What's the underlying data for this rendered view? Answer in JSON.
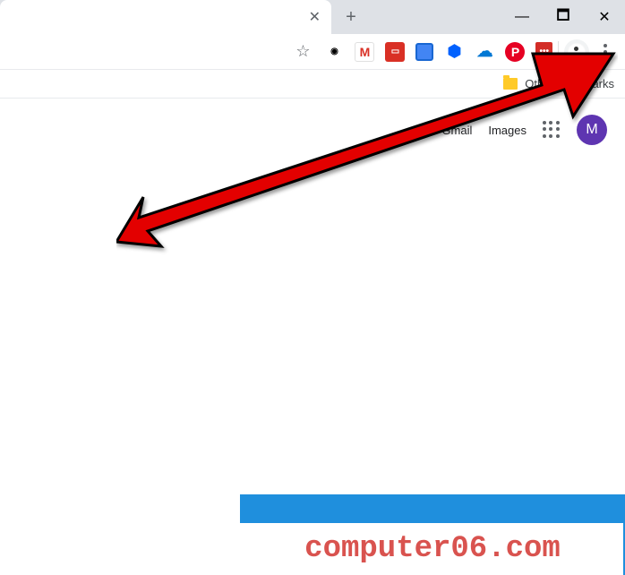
{
  "tabstrip": {
    "close_glyph": "✕",
    "new_tab_glyph": "+",
    "minimize_glyph": "—",
    "maximize_glyph": "🗖",
    "close_window_glyph": "✕"
  },
  "toolbar": {
    "star_glyph": "☆",
    "extensions": [
      {
        "name": "chrome-webstore-icon",
        "class": "ext-chrome",
        "glyph": "◉"
      },
      {
        "name": "gmail-icon",
        "class": "ext-gmail",
        "glyph": ""
      },
      {
        "name": "red-doc-icon",
        "class": "ext-red-doc",
        "glyph": "▭"
      },
      {
        "name": "blue-extension-icon",
        "class": "ext-blue",
        "glyph": ""
      },
      {
        "name": "dropbox-icon",
        "class": "ext-dropbox",
        "glyph": "⬢"
      },
      {
        "name": "onedrive-icon",
        "class": "ext-cloud",
        "glyph": "☁"
      },
      {
        "name": "pinterest-icon",
        "class": "ext-pinterest",
        "glyph": "P"
      },
      {
        "name": "lastpass-icon",
        "class": "ext-lastpass",
        "glyph": "•••"
      }
    ]
  },
  "bookmarks": {
    "other_label": "Other bookmarks"
  },
  "google": {
    "gmail_label": "Gmail",
    "images_label": "Images",
    "avatar_initial": "M"
  },
  "watermark": {
    "text": "computer06.com"
  }
}
